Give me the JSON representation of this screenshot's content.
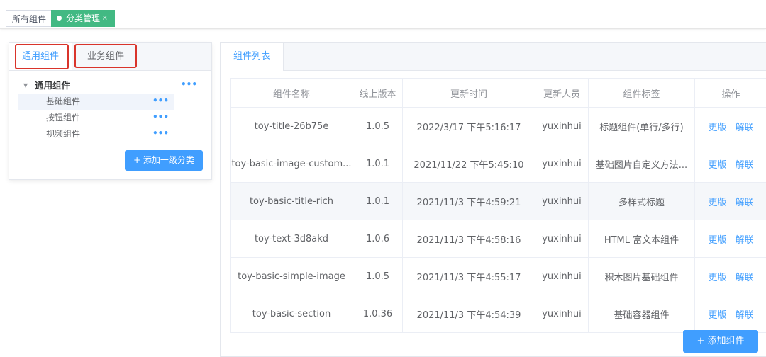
{
  "tagsbar": {
    "all_tag": "所有组件",
    "active_tag": "分类管理",
    "active_close": "×"
  },
  "left": {
    "tabs": [
      "通用组件",
      "业务组件"
    ],
    "tree": {
      "root": "通用组件",
      "children": [
        "基础组件",
        "按钮组件",
        "视频组件"
      ],
      "selected_index": 0,
      "more_glyph": "•••"
    },
    "add_category_label": "+ 添加一级分类"
  },
  "right": {
    "tab": "组件列表",
    "table": {
      "columns": [
        "组件名称",
        "线上版本",
        "更新时间",
        "更新人员",
        "组件标签",
        "操作"
      ],
      "rows": [
        [
          "toy-title-26b75e",
          "1.0.5",
          "2022/3/17 下午5:16:17",
          "yuxinhui",
          "标题组件(单行/多行)"
        ],
        [
          "toy-basic-image-custom...",
          "1.0.1",
          "2021/11/22 下午5:45:10",
          "yuxinhui",
          "基础图片自定义方法..."
        ],
        [
          "toy-basic-title-rich",
          "1.0.1",
          "2021/11/3 下午4:59:21",
          "yuxinhui",
          "多样式标题"
        ],
        [
          "toy-text-3d8akd",
          "1.0.6",
          "2021/11/3 下午4:58:16",
          "yuxinhui",
          "HTML 富文本组件"
        ],
        [
          "toy-basic-simple-image",
          "1.0.5",
          "2021/11/3 下午4:55:17",
          "yuxinhui",
          "积木图片基础组件"
        ],
        [
          "toy-basic-section",
          "1.0.36",
          "2021/11/3 下午4:54:39",
          "yuxinhui",
          "基础容器组件"
        ]
      ],
      "highlighted_row": 2,
      "actions": [
        "更版",
        "解联"
      ]
    },
    "add_component_label": "+ 添加组件"
  },
  "colors": {
    "primary": "#409eff",
    "active_tag": "#42b983",
    "highlight_box": "#d9342b"
  }
}
